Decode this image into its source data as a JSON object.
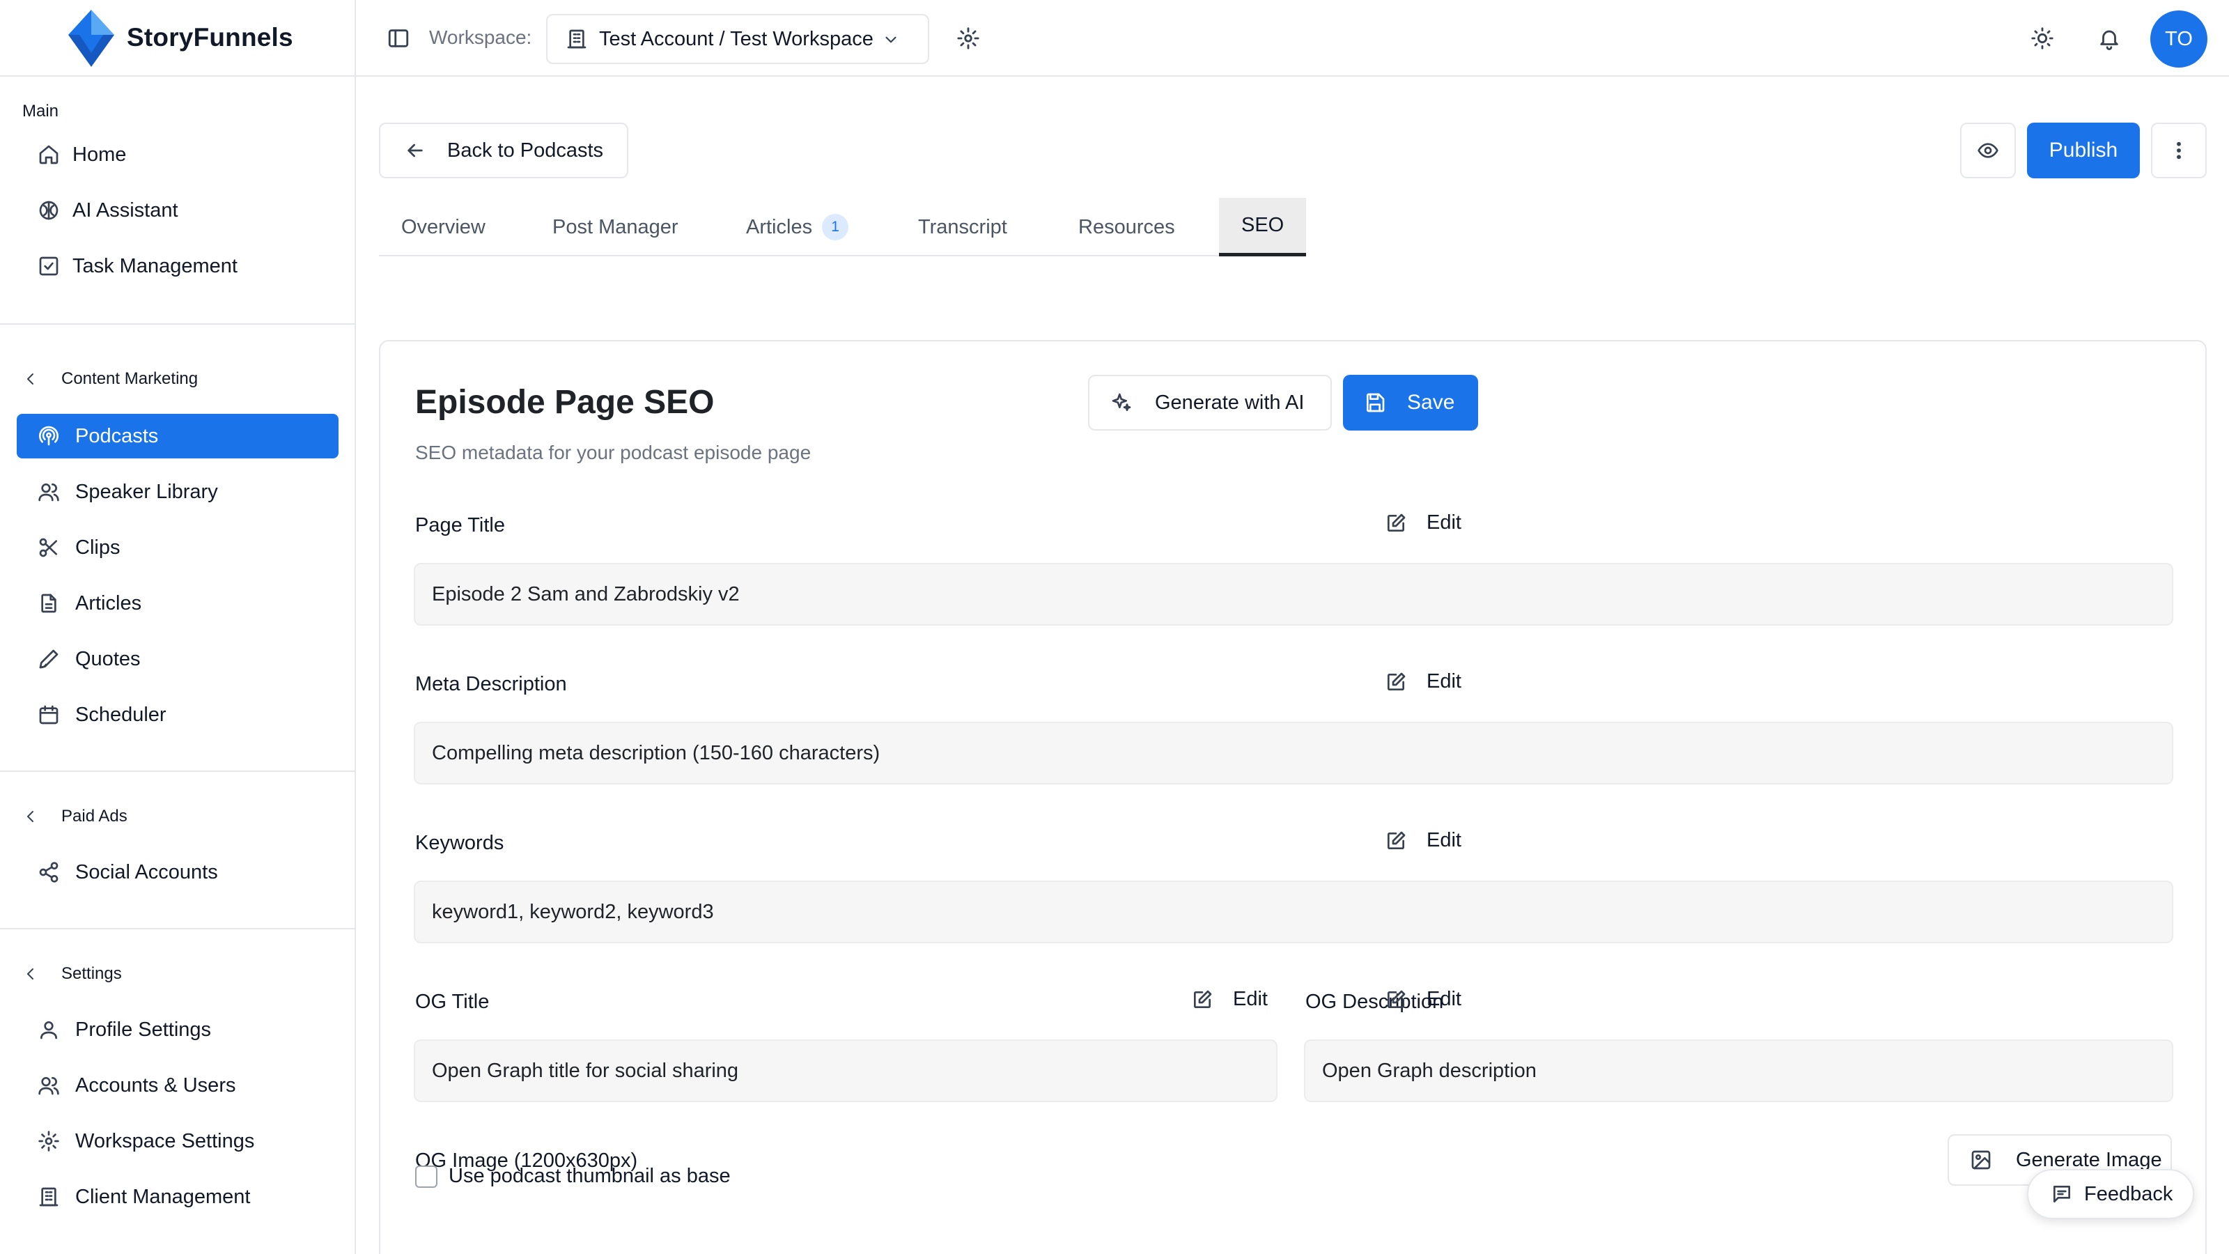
{
  "brand": {
    "name": "StoryFunnels",
    "logo_colors": [
      "#1a73e8",
      "#5aa9f5",
      "#0d47a1"
    ]
  },
  "topbar": {
    "workspace_label": "Workspace:",
    "workspace_value": "Test Account / Test Workspace",
    "avatar_initials": "TO"
  },
  "sidebar": {
    "main_label": "Main",
    "main_items": [
      {
        "label": "Home",
        "icon": "home-icon"
      },
      {
        "label": "AI Assistant",
        "icon": "brain-icon"
      },
      {
        "label": "Task Management",
        "icon": "checkbox-icon"
      }
    ],
    "content_marketing": {
      "label": "Content Marketing",
      "items": [
        {
          "label": "Podcasts",
          "icon": "podcast-icon",
          "active": true
        },
        {
          "label": "Speaker Library",
          "icon": "users-icon"
        },
        {
          "label": "Clips",
          "icon": "scissors-icon"
        },
        {
          "label": "Articles",
          "icon": "file-icon"
        },
        {
          "label": "Quotes",
          "icon": "pen-icon"
        },
        {
          "label": "Scheduler",
          "icon": "calendar-icon"
        }
      ]
    },
    "paid_ads": {
      "label": "Paid Ads",
      "items": [
        {
          "label": "Social Accounts",
          "icon": "share-icon"
        }
      ]
    },
    "settings": {
      "label": "Settings",
      "items": [
        {
          "label": "Profile Settings",
          "icon": "user-icon"
        },
        {
          "label": "Accounts & Users",
          "icon": "users-icon"
        },
        {
          "label": "Workspace Settings",
          "icon": "gear-icon"
        },
        {
          "label": "Client Management",
          "icon": "building-icon"
        }
      ]
    }
  },
  "header": {
    "back_label": "Back to Podcasts",
    "publish_label": "Publish"
  },
  "tabs": [
    {
      "label": "Overview"
    },
    {
      "label": "Post Manager"
    },
    {
      "label": "Articles",
      "badge": "1"
    },
    {
      "label": "Transcript"
    },
    {
      "label": "Resources"
    },
    {
      "label": "SEO",
      "active": true
    }
  ],
  "seo": {
    "title": "Episode Page SEO",
    "subtitle": "SEO metadata for your podcast episode page",
    "generate_label": "Generate with AI",
    "save_label": "Save",
    "edit_label": "Edit",
    "fields": {
      "page_title": {
        "label": "Page Title",
        "value": "Episode 2   Sam and Zabrodskiy v2"
      },
      "meta_description": {
        "label": "Meta Description",
        "value": "Compelling meta description (150-160 characters)"
      },
      "keywords": {
        "label": "Keywords",
        "value": "keyword1, keyword2, keyword3"
      },
      "og_title": {
        "label": "OG Title",
        "value": "Open Graph title for social sharing"
      },
      "og_description": {
        "label": "OG Description",
        "value": "Open Graph description"
      },
      "og_image": {
        "label": "OG Image (1200x630px)"
      }
    },
    "generate_image_label": "Generate Image",
    "thumbnail_checkbox_label": "Use podcast thumbnail as base",
    "thumbnail_checked": false
  },
  "feedback_label": "Feedback",
  "accent_color": "#1a73e8"
}
